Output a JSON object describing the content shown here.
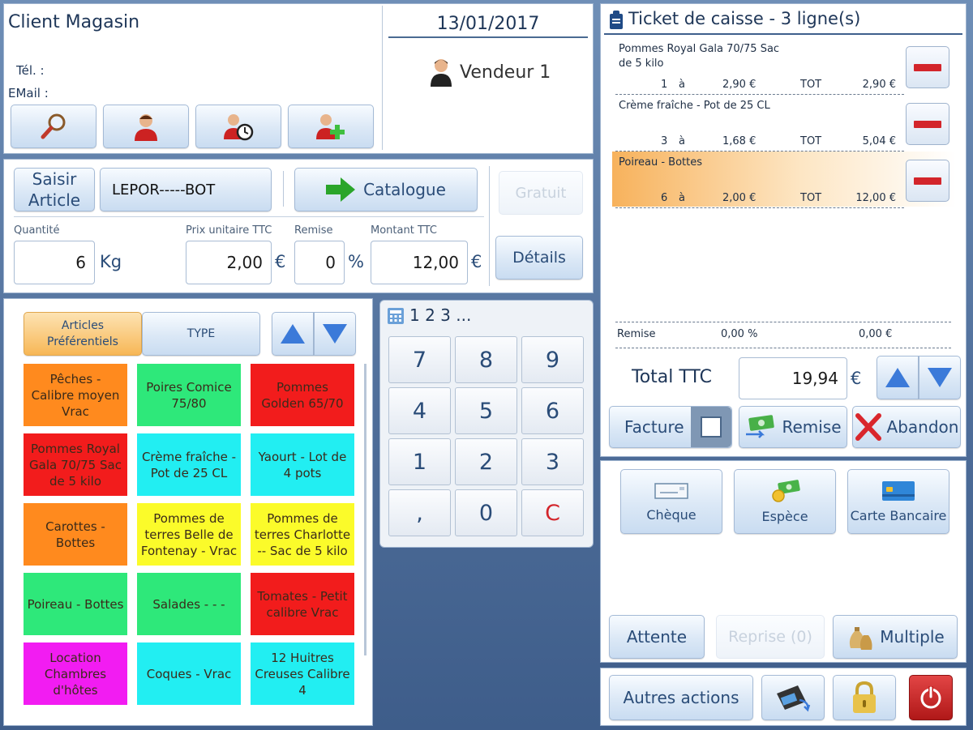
{
  "client": {
    "title": "Client Magasin",
    "tel_label": "Tél. :",
    "email_label": "EMail :",
    "date": "13/01/2017",
    "vendor": "Vendeur 1"
  },
  "article": {
    "saisir_line1": "Saisir",
    "saisir_line2": "Article",
    "code": "LEPOR-----BOT",
    "catalogue": "Catalogue",
    "gratuit": "Gratuit",
    "details": "Détails",
    "qty_label": "Quantité",
    "qty_value": "6",
    "qty_unit": "Kg",
    "price_label": "Prix unitaire TTC",
    "price_value": "2,00",
    "currency": "€",
    "remise_label": "Remise",
    "remise_value": "0",
    "percent": "%",
    "montant_label": "Montant TTC",
    "montant_value": "12,00"
  },
  "catalog": {
    "tab_pref_line1": "Articles",
    "tab_pref_line2": "Préférentiels",
    "tab_type": "TYPE",
    "tiles": [
      {
        "label": "Pêches - Calibre moyen Vrac",
        "color": "#ff8a1e"
      },
      {
        "label": "Poires Comice 75/80",
        "color": "#2ee87a"
      },
      {
        "label": "Pommes Golden 65/70",
        "color": "#f21c1c"
      },
      {
        "label": "Pommes Royal Gala 70/75 Sac de 5 kilo",
        "color": "#f21c1c"
      },
      {
        "label": "Crème fraîche - Pot de 25 CL",
        "color": "#22eef2"
      },
      {
        "label": "Yaourt - Lot de 4 pots",
        "color": "#22eef2"
      },
      {
        "label": "Carottes - Bottes",
        "color": "#ff8a1e"
      },
      {
        "label": "Pommes de terres Belle de Fontenay - Vrac",
        "color": "#fbfb2a"
      },
      {
        "label": "Pommes de terres Charlotte -- Sac de 5 kilo",
        "color": "#fbfb2a"
      },
      {
        "label": "Poireau - Bottes",
        "color": "#2ee87a"
      },
      {
        "label": "Salades - - -",
        "color": "#2ee87a"
      },
      {
        "label": "Tomates - Petit calibre Vrac",
        "color": "#f21c1c"
      },
      {
        "label": "Location Chambres d'hôtes",
        "color": "#f21cf2"
      },
      {
        "label": "Coques - Vrac",
        "color": "#22eef2"
      },
      {
        "label": "12 Huitres Creuses Calibre 4",
        "color": "#22eef2"
      }
    ]
  },
  "keypad": {
    "title": "1 2 3 ...",
    "keys": [
      "7",
      "8",
      "9",
      "4",
      "5",
      "6",
      "1",
      "2",
      "3",
      ",",
      "0",
      "C"
    ]
  },
  "ticket": {
    "title": "Ticket de caisse - 3 ligne(s)",
    "lines": [
      {
        "name_1": "Pommes Royal Gala 70/75 Sac",
        "name_2": "de 5 kilo",
        "qty": "1",
        "at": "à",
        "price": "2,90 €",
        "tot": "TOT",
        "total": "2,90 €"
      },
      {
        "name_1": "Crème fraîche - Pot de 25 CL",
        "name_2": "",
        "qty": "3",
        "at": "à",
        "price": "1,68 €",
        "tot": "TOT",
        "total": "5,04 €"
      },
      {
        "name_1": "Poireau - Bottes",
        "name_2": "",
        "qty": "6",
        "at": "à",
        "price": "2,00 €",
        "tot": "TOT",
        "total": "12,00 €"
      }
    ],
    "remise_label": "Remise",
    "remise_pct": "0,00 %",
    "remise_amount": "0,00 €",
    "total_label": "Total TTC",
    "total_value": "19,94",
    "currency": "€",
    "facture": "Facture",
    "remise_btn": "Remise",
    "abandon": "Abandon"
  },
  "payment": {
    "cheque": "Chèque",
    "espece": "Espèce",
    "carte": "Carte Bancaire",
    "attente": "Attente",
    "reprise": "Reprise (0)",
    "multiple": "Multiple",
    "autres": "Autres actions"
  },
  "colors": {
    "accent_red": "#d3252b",
    "selected_line": "#f7b25c",
    "active_tab": "#f9c36a"
  }
}
